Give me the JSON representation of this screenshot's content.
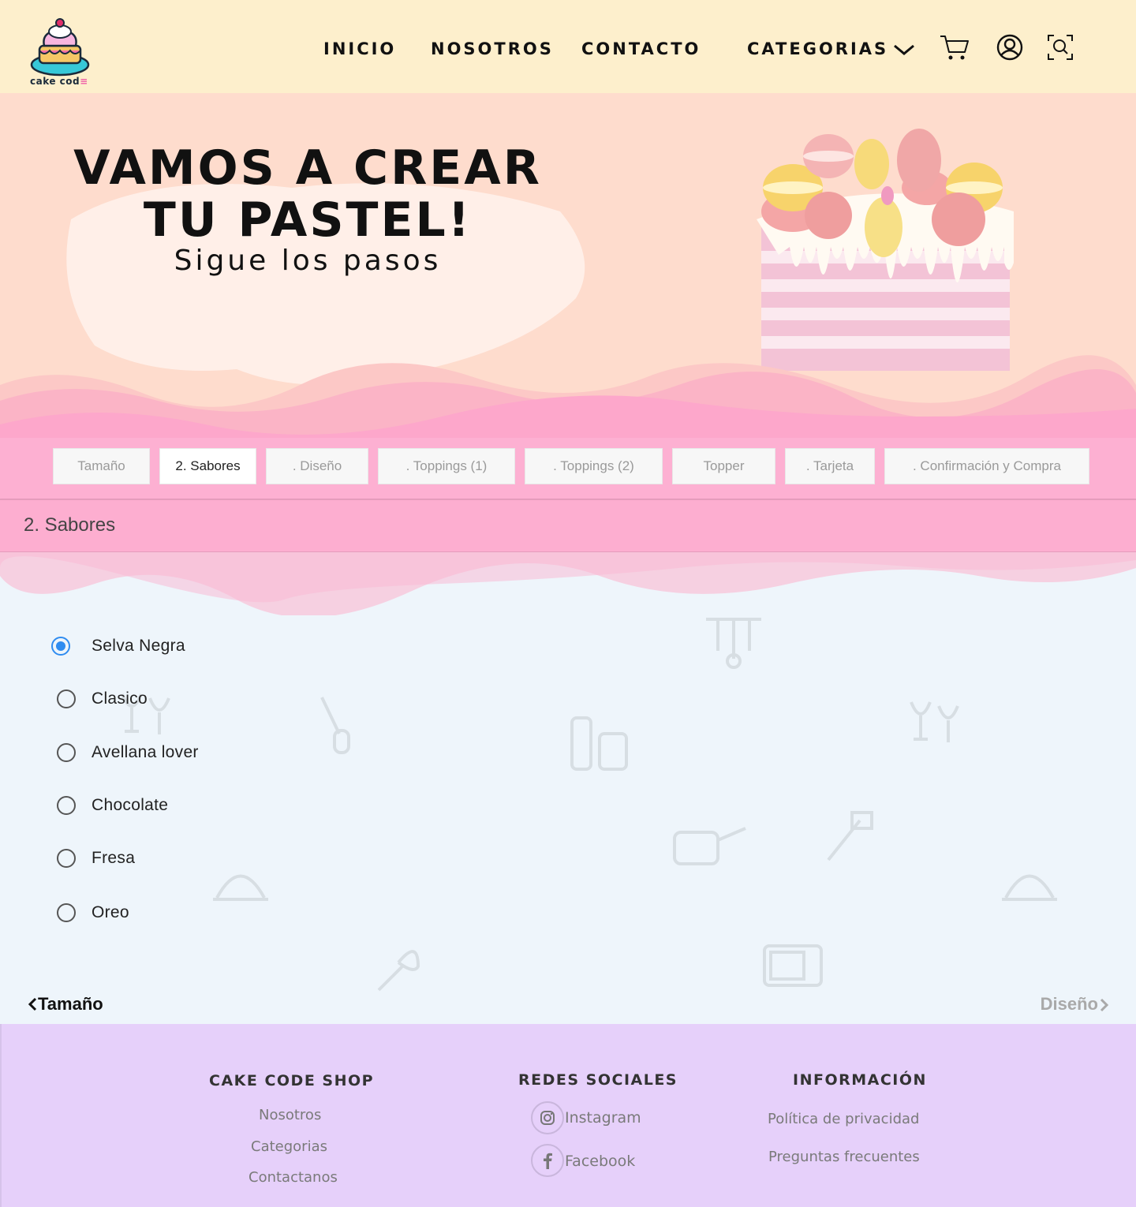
{
  "brand": {
    "name_dark": "cake cod",
    "name_accent": "≡"
  },
  "nav": {
    "inicio": "INICIO",
    "nosotros": "NOSOTROS",
    "contacto": "CONTACTO",
    "categorias": "CATEGORIAS"
  },
  "hero": {
    "title_line1": "Vamos a crear",
    "title_line2": "tu pastel!",
    "subtitle": "Sigue los pasos"
  },
  "steps": [
    {
      "label": "Tamaño"
    },
    {
      "label": "2. Sabores"
    },
    {
      "label": ". Diseño"
    },
    {
      "label": ". Toppings (1)"
    },
    {
      "label": ". Toppings (2)"
    },
    {
      "label": "Topper"
    },
    {
      "label": ". Tarjeta"
    },
    {
      "label": ". Confirmación y Compra"
    }
  ],
  "section": {
    "title": "2. Sabores"
  },
  "flavors": {
    "selected": "Selva Negra",
    "options": [
      "Selva Negra",
      "Clasico",
      "Avellana lover",
      "Chocolate",
      "Fresa",
      "Oreo"
    ]
  },
  "navigation": {
    "prev": "Tamaño",
    "next": "Diseño"
  },
  "footer": {
    "shop": {
      "heading": "CAKE CODE SHOP",
      "links": [
        "Nosotros",
        "Categorias",
        "Contactanos"
      ]
    },
    "social": {
      "heading": "REDES SOCIALES",
      "links": [
        "Instagram",
        "Facebook"
      ]
    },
    "info": {
      "heading": "INFORMACIÓN",
      "links": [
        "Política de privacidad",
        "Preguntas frecuentes"
      ]
    }
  },
  "colors": {
    "header_bg": "#fdefcc",
    "hero_bg": "#fedccd",
    "pink": "#fdb0d2",
    "main_bg": "#eef5fb",
    "footer_bg": "#e6d0fa",
    "radio_accent": "#2f8cf0"
  }
}
